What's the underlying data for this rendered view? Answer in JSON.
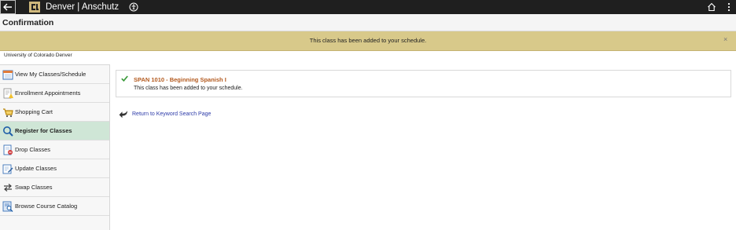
{
  "header": {
    "brand": "Denver | Anschutz"
  },
  "page": {
    "title": "Confirmation"
  },
  "banner": {
    "message": "This class has been added to your schedule.",
    "close": "×"
  },
  "campus": "University of Colorado Denver",
  "sidebar": {
    "items": [
      {
        "label": "View My Classes/Schedule",
        "icon": "calendar-icon"
      },
      {
        "label": "Enrollment Appointments",
        "icon": "appointment-icon"
      },
      {
        "label": "Shopping Cart",
        "icon": "cart-icon"
      },
      {
        "label": "Register for Classes",
        "icon": "search-icon",
        "active": true
      },
      {
        "label": "Drop Classes",
        "icon": "drop-icon"
      },
      {
        "label": "Update Classes",
        "icon": "edit-icon"
      },
      {
        "label": "Swap Classes",
        "icon": "swap-icon"
      },
      {
        "label": "Browse Course Catalog",
        "icon": "catalog-icon"
      }
    ]
  },
  "result": {
    "course": "SPAN 1010 - Beginning Spanish I",
    "message": "This class has been added to your schedule."
  },
  "return_link": {
    "label": "Return to Keyword Search Page"
  },
  "colors": {
    "banner": "#d8c98a",
    "course_title": "#b35a1f",
    "link": "#2c3aa8",
    "active_nav": "#cfe6d6"
  }
}
